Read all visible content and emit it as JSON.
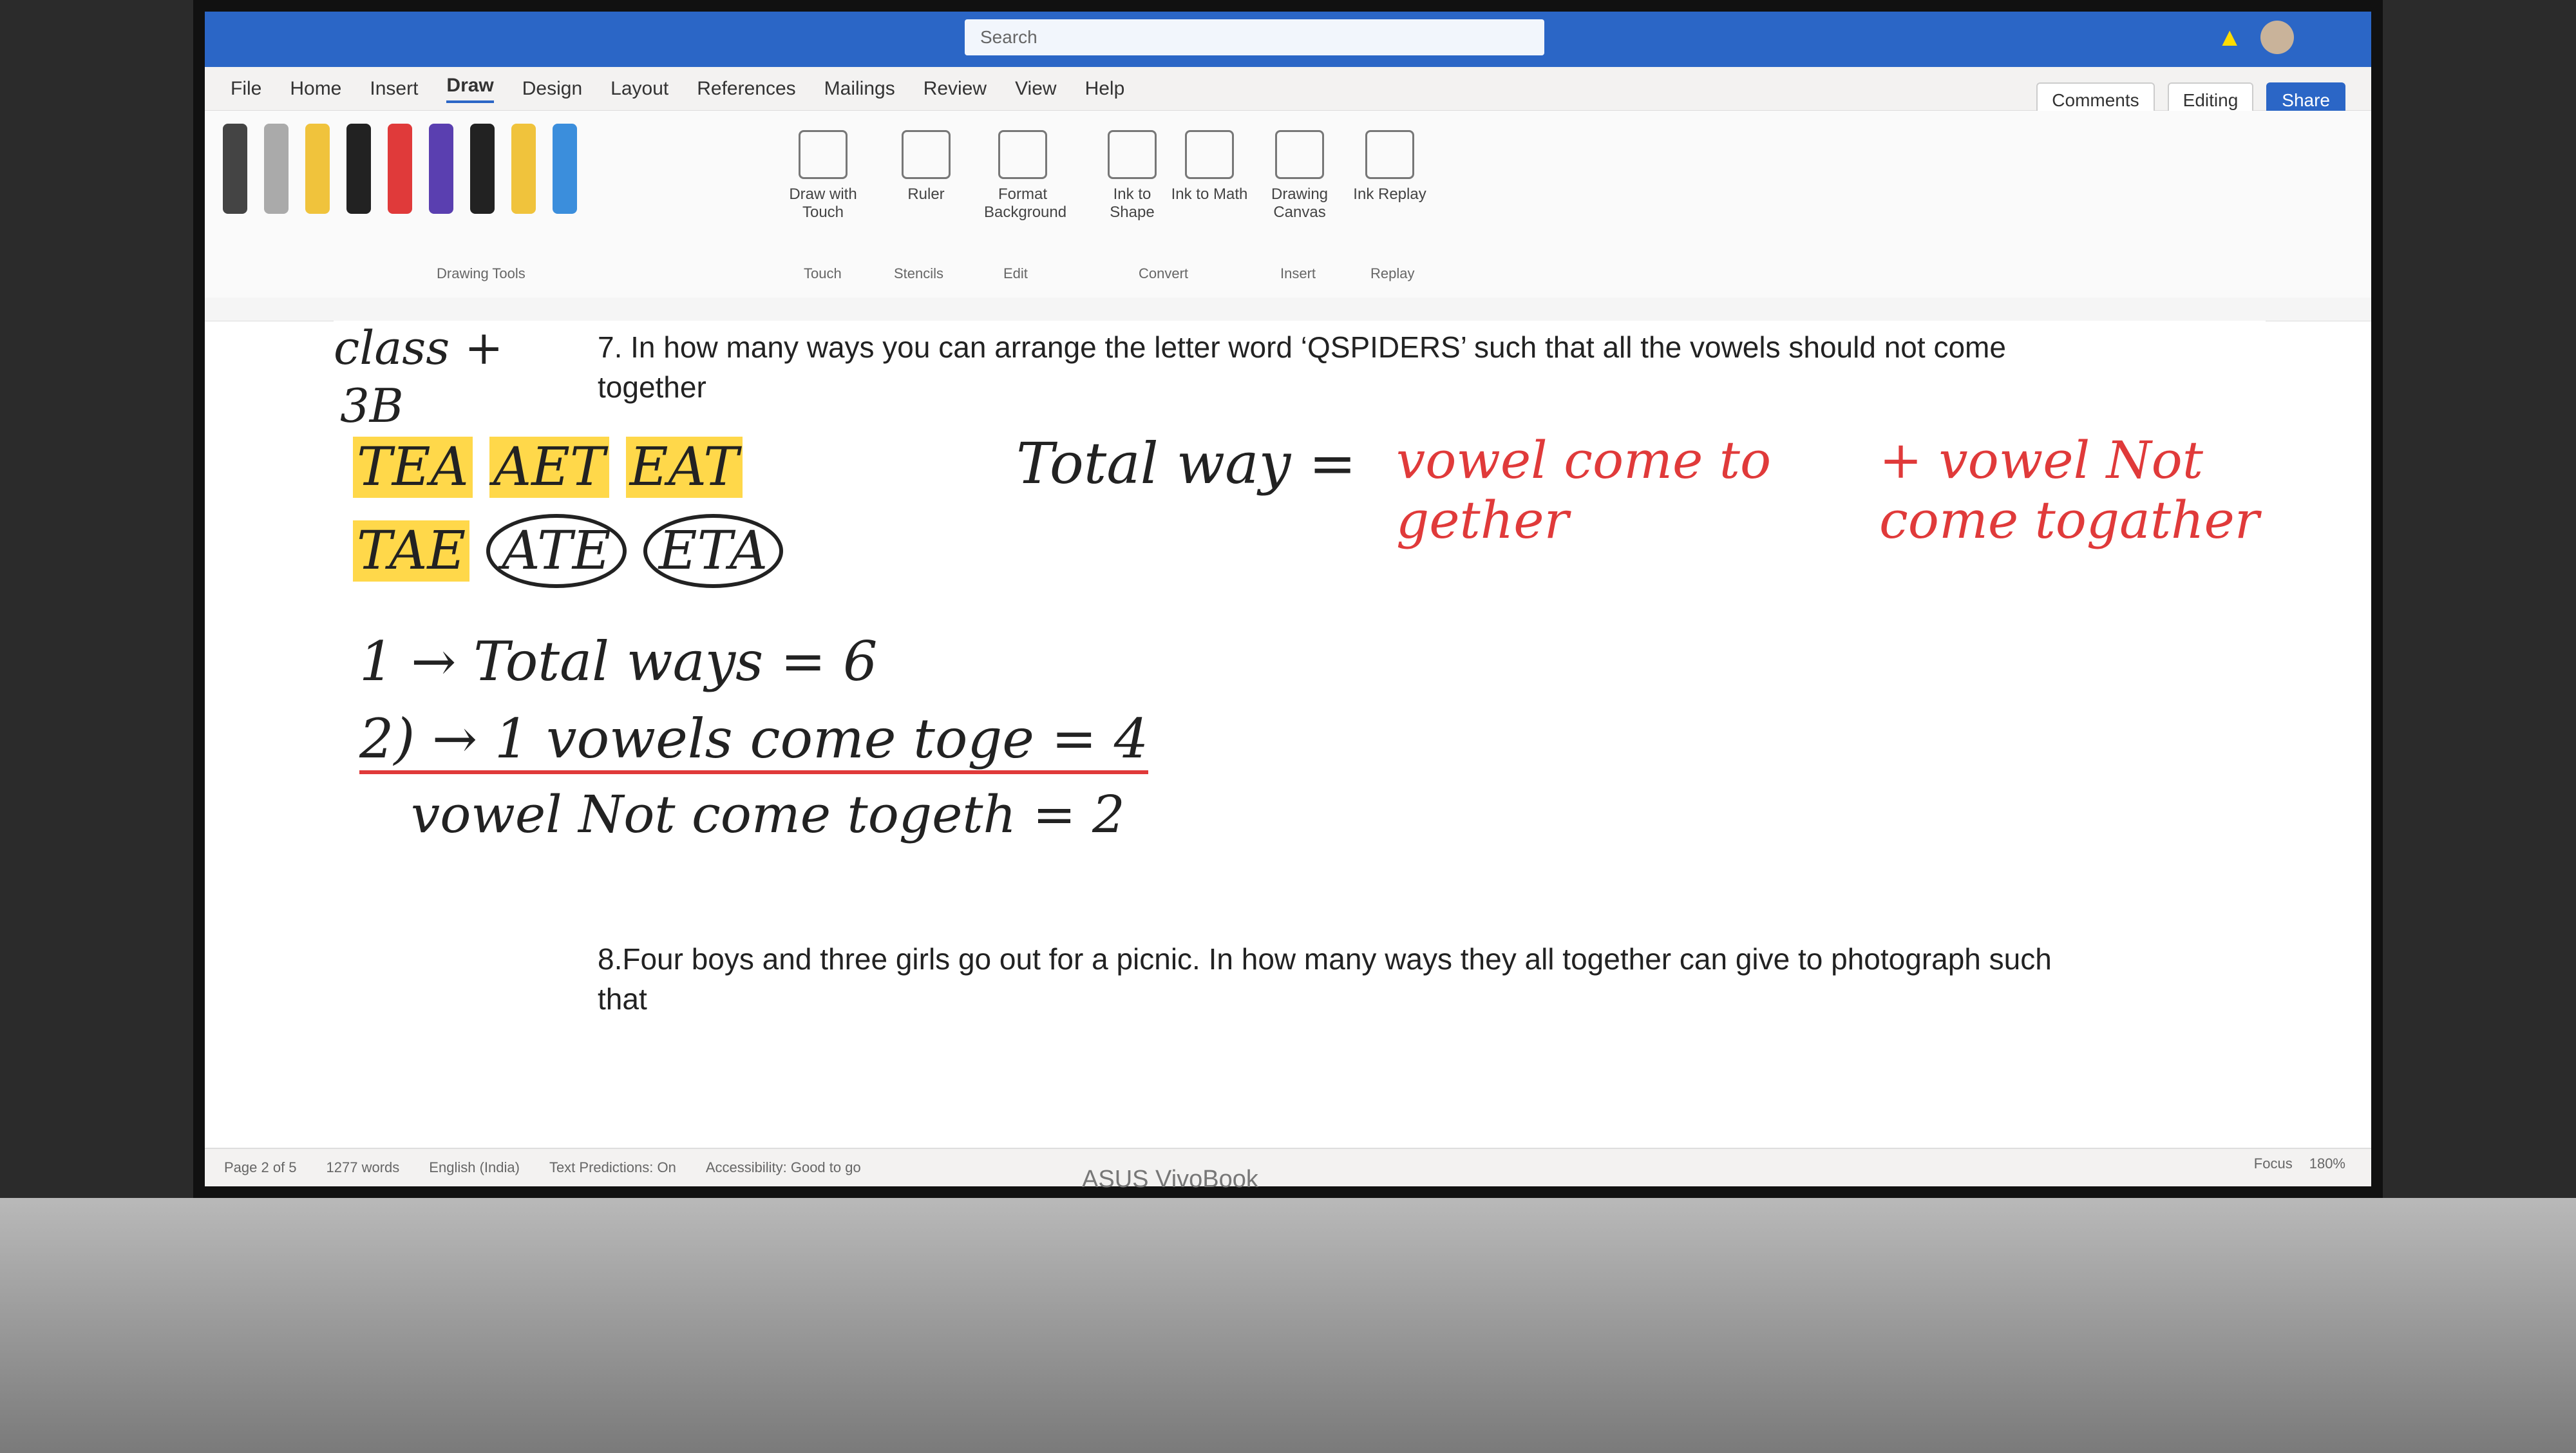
{
  "app": {
    "ribbon_tabs": [
      "File",
      "Home",
      "Insert",
      "Draw",
      "Design",
      "Layout",
      "References",
      "Mailings",
      "Review",
      "View",
      "Help"
    ],
    "active_tab": "Draw",
    "search_placeholder": "Search"
  },
  "right_controls": {
    "comments_label": "Comments",
    "editing_label": "Editing",
    "share_label": "Share"
  },
  "ribbon": {
    "drawing_tools_label": "Drawing Tools",
    "buttons": [
      {
        "label": "Draw with Touch",
        "group": "Touch"
      },
      {
        "label": "Ruler",
        "group": "Stencils"
      },
      {
        "label": "Format Background",
        "group": "Edit"
      },
      {
        "label": "Ink to Shape",
        "group": "Convert"
      },
      {
        "label": "Ink to Math",
        "group": "Convert"
      },
      {
        "label": "Drawing Canvas",
        "group": "Insert"
      },
      {
        "label": "Ink Replay",
        "group": "Replay"
      }
    ]
  },
  "document": {
    "q7_text": "7. In how many ways you can arrange the letter word ‘QSPIDERS’ such that all the vowels should not come together",
    "q8_text": "8.Four boys and three girls go out for a picnic. In how many ways they all together can give to photograph such that",
    "margin_note_1": "class +",
    "margin_note_2": "3B",
    "arrangements_row_1": [
      "TEA",
      "AET",
      "EAT"
    ],
    "arrangements_row_2": [
      "TAE",
      "ATE",
      "ETA"
    ],
    "formula_left": "Total way =",
    "formula_right_1": "vowel come to gether",
    "formula_right_2": "+ vowel Not come togather",
    "line_1": "1 → Total ways = 6",
    "line_2": "2) → 1 vowels come toge = 4",
    "line_3": "vowel Not come togeth = 2"
  },
  "status": {
    "page": "Page 2 of 5",
    "words": "1277 words",
    "language": "English (India)",
    "text_predictions": "Text Predictions: On",
    "accessibility": "Accessibility: Good to go",
    "focus": "Focus",
    "zoom": "180%"
  },
  "device": {
    "brand": "ASUS VivoBook"
  },
  "colors": {
    "title_bar": "#2b66c6",
    "ink_red": "#e03a3a",
    "highlight_yellow": "#ffd84a"
  }
}
